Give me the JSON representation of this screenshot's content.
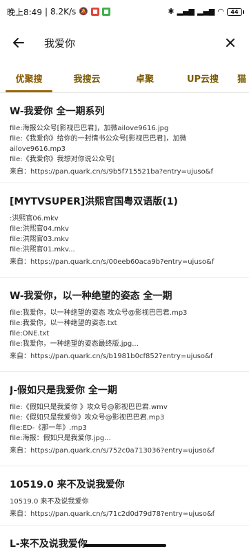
{
  "status_bar": {
    "time": "晚上8:49",
    "network_speed": "8.2K/s",
    "battery_level": "44"
  },
  "search": {
    "query": "我爱你"
  },
  "tabs": [
    {
      "label": "优聚搜",
      "active": true
    },
    {
      "label": "我搜云",
      "active": false
    },
    {
      "label": "卓聚",
      "active": false
    },
    {
      "label": "UP云搜",
      "active": false
    },
    {
      "label": "猫",
      "active": false
    }
  ],
  "results": [
    {
      "title": "W-我爱你 全一期系列",
      "files": [
        "file:海报公众号[影视巴巴君]，加微ailove9616.jpg",
        "file:《我爱你》给你的一封情书公众号[影视巴巴君]，加微ailove9616.mp3",
        "file:《我爱你》我想对你说公众号["
      ],
      "source": "来自：https://pan.quark.cn/s/9b5f715521ba?entry=ujuso&f"
    },
    {
      "title": "[MYTVSUPER]洪熙官国粤双语版(1)",
      "files": [
        ":洪熙官06.mkv",
        "file:洪熙官04.mkv",
        "file:洪熙官03.mkv",
        "file:洪熙官01.mkv..."
      ],
      "source": "来自：https://pan.quark.cn/s/00eeb60aca9b?entry=ujuso&f"
    },
    {
      "title": "W-我爱你，以一种绝望的姿态 全一期",
      "files": [
        "file:我爱你，以一种绝望的姿态 攻众号@影视巴巴君.mp3",
        "file:我爱你，以一种绝望的姿态.txt",
        "file:ONE.txt",
        "file:我爱你，一种绝望的姿态最终版.jpg..."
      ],
      "source": "来自：https://pan.quark.cn/s/b1981b0cf852?entry=ujuso&f"
    },
    {
      "title": "J-假如只是我爱你 全一期",
      "files": [
        "file:《假如只是我爱你 》攻众号@影视巴巴君.wmv",
        "file:《假如只是我爱你》攻众号@影视巴巴君.mp3",
        "file:ED-《那一年》.mp3",
        "file:海报：假如只是我爱你.jpg..."
      ],
      "source": "来自：https://pan.quark.cn/s/752c0a713036?entry=ujuso&f"
    },
    {
      "title": "10519.0 来不及说我爱你",
      "files": [
        "10519.0 来不及说我爱你"
      ],
      "source": "来自：https://pan.quark.cn/s/71c2d0d79d78?entry=ujuso&f"
    },
    {
      "title": "L-来不及说我爱你",
      "files": [],
      "source": ""
    }
  ]
}
